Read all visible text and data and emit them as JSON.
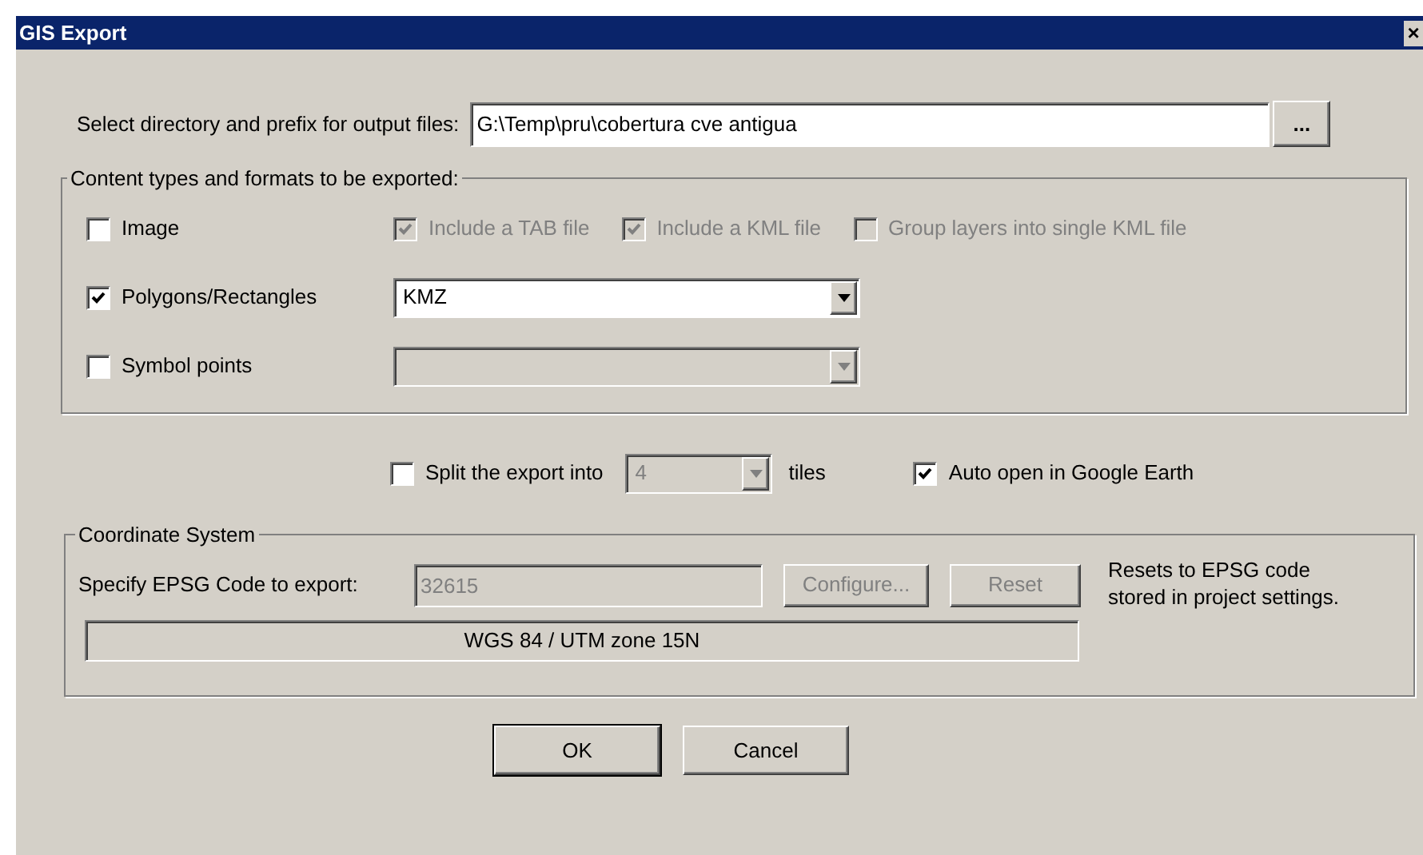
{
  "window": {
    "title": "GIS Export",
    "close": "×"
  },
  "output": {
    "label": "Select directory and prefix for output files:",
    "value": "G:\\Temp\\pru\\cobertura cve antigua",
    "browse": "..."
  },
  "content_group": {
    "legend": "Content types and formats to be exported:",
    "rows": [
      {
        "kind": "options",
        "label": "Image",
        "checked": false,
        "options": [
          {
            "label": "Include a TAB file",
            "checked": true,
            "disabled": true
          },
          {
            "label": "Include a KML file",
            "checked": true,
            "disabled": true
          },
          {
            "label": "Group layers into single KML file",
            "checked": false,
            "disabled": true
          }
        ]
      },
      {
        "kind": "format",
        "label": "Polygons/Rectangles",
        "checked": true,
        "format": {
          "value": "KMZ",
          "disabled": false
        }
      },
      {
        "kind": "format",
        "label": "Symbol points",
        "checked": false,
        "format": {
          "disabled": true
        }
      }
    ]
  },
  "split": {
    "label": "Split the export into",
    "checked": false,
    "tiles": {
      "value": "4",
      "disabled": true
    },
    "suffix": "tiles"
  },
  "auto_open": {
    "label": "Auto open in Google Earth",
    "checked": true
  },
  "coordinate_system": {
    "legend": "Coordinate System",
    "epsg_label": "Specify EPSG Code to export:",
    "epsg": {
      "value": "32615",
      "disabled": true
    },
    "buttons": [
      {
        "label": "Configure...",
        "disabled": true
      },
      {
        "label": "Reset",
        "disabled": true
      }
    ],
    "note": "Resets to EPSG code stored in project settings.",
    "projection": "WGS 84 / UTM zone 15N"
  },
  "buttons": [
    {
      "label": "OK",
      "default": true
    },
    {
      "label": "Cancel",
      "default": false
    }
  ]
}
